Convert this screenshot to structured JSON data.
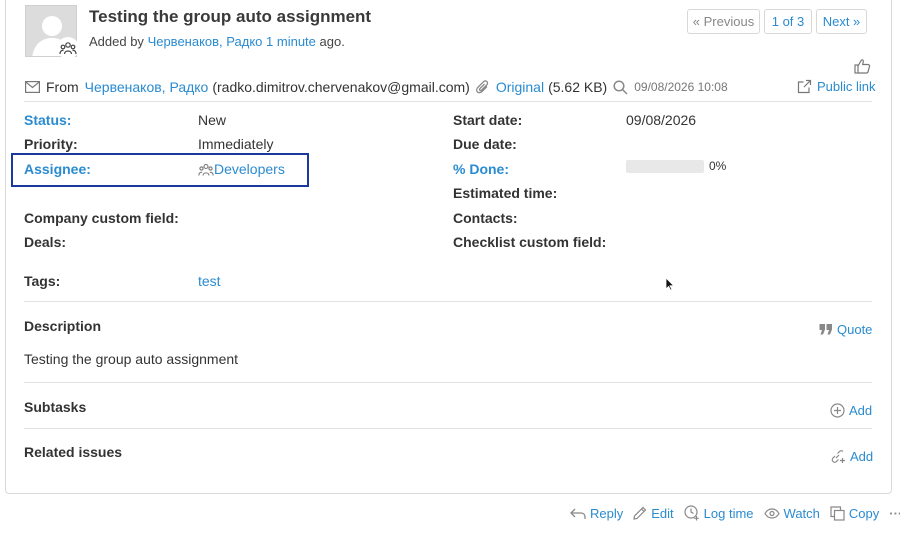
{
  "issue": {
    "title": "Testing the group auto assignment",
    "added_by_prefix": "Added by",
    "author": "Червенаков, Радко",
    "time_ago": "1 minute",
    "ago_suffix": "ago."
  },
  "pager": {
    "previous": "« Previous",
    "count": "1 of 3",
    "next": "Next »"
  },
  "email": {
    "from_label": "From",
    "sender_name": "Червенаков, Радко",
    "sender_email": "(radko.dimitrov.chervenakov@gmail.com)",
    "original_label": "Original",
    "original_size": "(5.62 KB)",
    "datetime": "09/08/2026 10:08",
    "public_link": "Public link"
  },
  "fields": {
    "status_label": "Status:",
    "status_value": "New",
    "priority_label": "Priority:",
    "priority_value": "Immediately",
    "assignee_label": "Assignee:",
    "assignee_value": "Developers",
    "company_label": "Company custom field:",
    "deals_label": "Deals:",
    "start_label": "Start date:",
    "start_value": "09/08/2026",
    "due_label": "Due date:",
    "done_label": "% Done:",
    "done_value": "0%",
    "done_percent": 0,
    "estimated_label": "Estimated time:",
    "contacts_label": "Contacts:",
    "checklist_label": "Checklist custom field:",
    "tags_label": "Tags:",
    "tags_value": "test"
  },
  "description": {
    "title": "Description",
    "quote_label": "Quote",
    "text": "Testing the group auto assignment"
  },
  "subtasks": {
    "title": "Subtasks",
    "add_label": "Add"
  },
  "related": {
    "title": "Related issues",
    "add_label": "Add"
  },
  "actions": {
    "reply": "Reply",
    "edit": "Edit",
    "log_time": "Log time",
    "watch": "Watch",
    "copy": "Copy",
    "more": "···"
  },
  "colors": {
    "link": "#2a8bd0",
    "highlight_box": "#1b3a9e"
  }
}
